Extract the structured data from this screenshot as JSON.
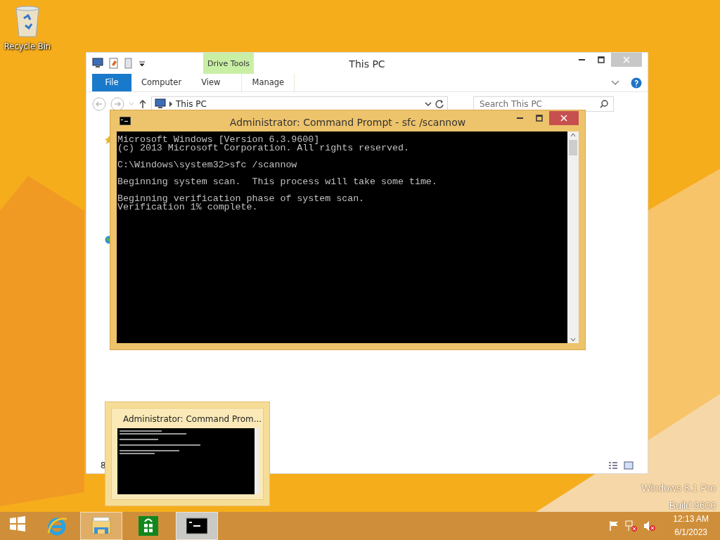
{
  "desktop": {
    "icons": [
      {
        "label": "Recycle Bin"
      }
    ],
    "watermark": [
      "Windows 8.1 Pro",
      "Build 9600"
    ]
  },
  "explorer": {
    "title": "This PC",
    "contextual_group": "Drive Tools",
    "ribbon_tabs": [
      {
        "label": "File",
        "kind": "file"
      },
      {
        "label": "Computer",
        "kind": "tab"
      },
      {
        "label": "View",
        "kind": "tab"
      },
      {
        "label": "Manage",
        "kind": "contextual"
      }
    ],
    "address": "This PC",
    "search": {
      "placeholder": "Search This PC"
    },
    "status_bar": "8"
  },
  "console": {
    "title": "Administrator: Command Prompt - sfc  /scannow",
    "paragraphs": [
      [
        "Microsoft Windows [Version 6.3.9600]",
        "(c) 2013 Microsoft Corporation. All rights reserved."
      ],
      [
        "C:\\Windows\\system32>sfc /scannow"
      ],
      [
        "Beginning system scan.  This process will take some time."
      ],
      [
        "Beginning verification phase of system scan.",
        "Verification 1% complete."
      ]
    ]
  },
  "thumbnail": {
    "title": "Administrator: Command Prom..."
  },
  "taskbar": {
    "items": [
      {
        "kind": "start",
        "running": false,
        "selected": false
      },
      {
        "kind": "ie",
        "running": false,
        "selected": false
      },
      {
        "kind": "explorer",
        "running": true,
        "selected": false
      },
      {
        "kind": "store",
        "running": false,
        "selected": false
      },
      {
        "kind": "cmd",
        "running": true,
        "selected": true
      }
    ],
    "clock": {
      "time": "12:13 AM",
      "date": "6/1/2023"
    }
  }
}
